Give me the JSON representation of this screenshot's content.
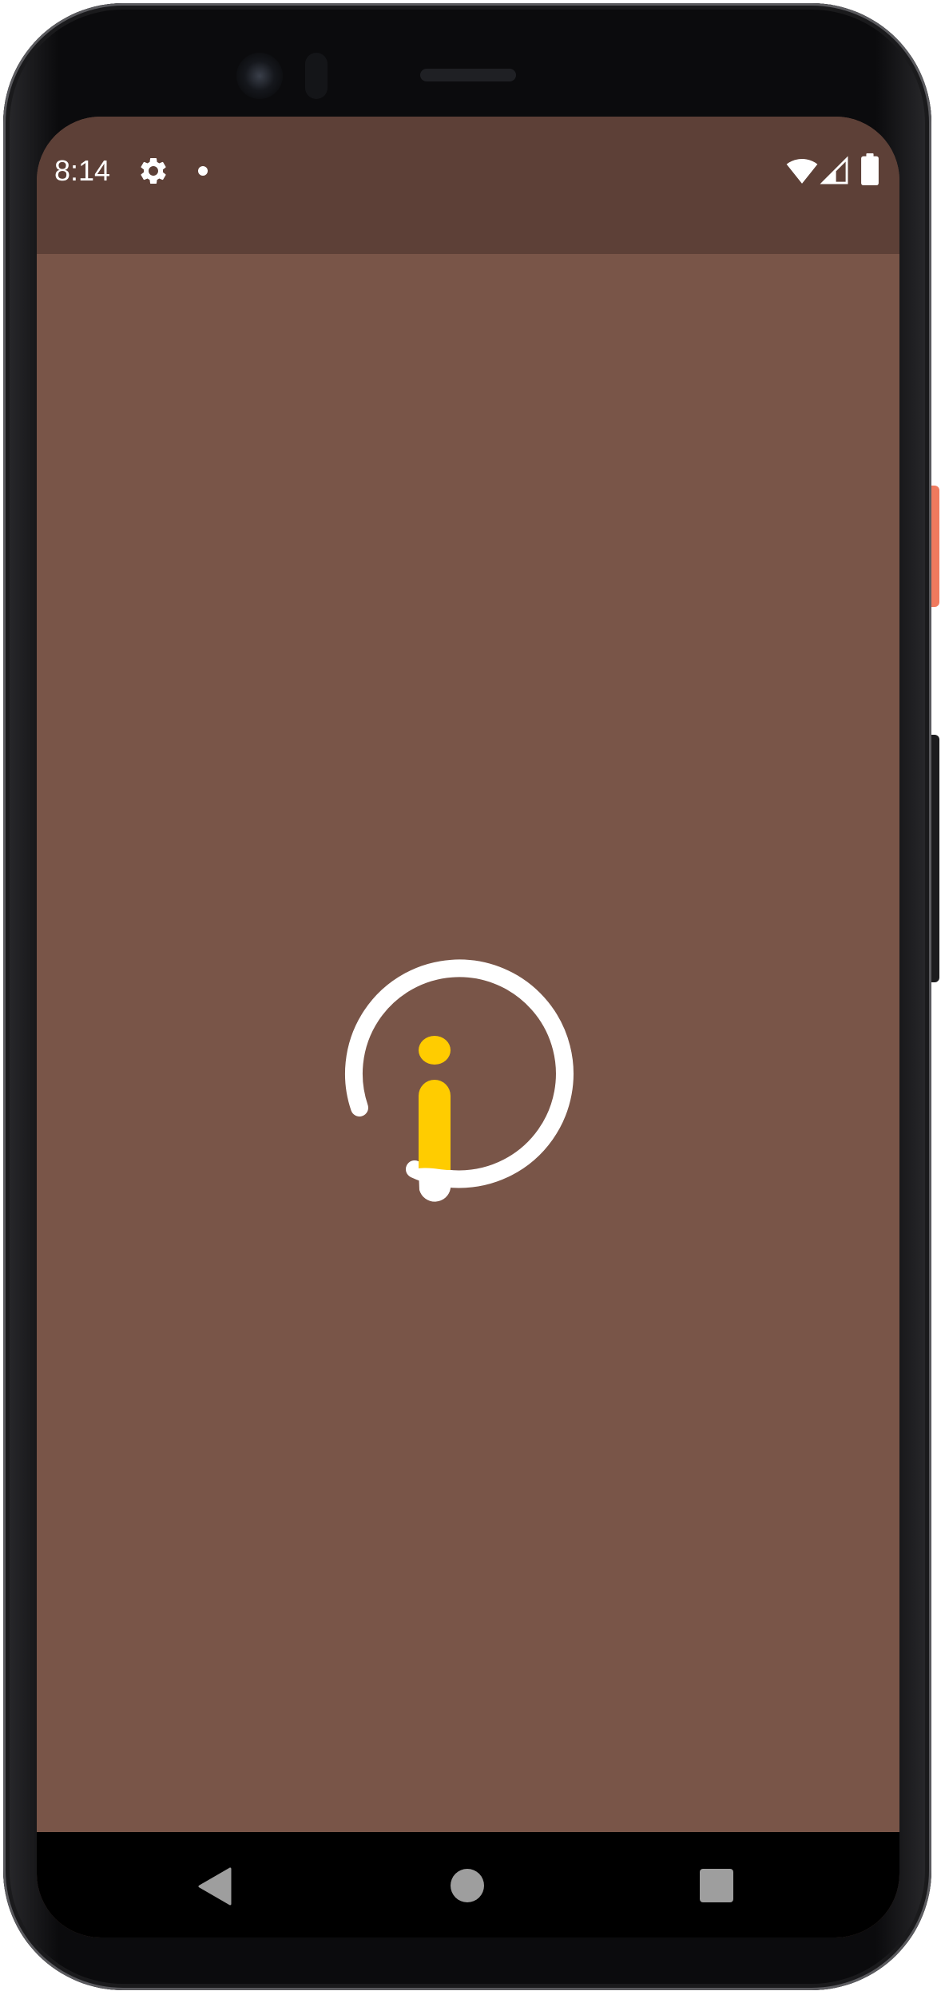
{
  "status_bar": {
    "time": "8:14",
    "icons": [
      "gear-icon",
      "notification-dot-icon",
      "wifi-icon",
      "cell-signal-icon",
      "battery-icon"
    ],
    "background_color": "#5d4037"
  },
  "app": {
    "background_color": "#795548",
    "logo": {
      "icon": "app-logo-i-icon",
      "ring_color": "#ffffff",
      "accent_color": "#ffcc00"
    }
  },
  "nav_bar": {
    "buttons": [
      "back-icon",
      "home-icon",
      "recents-icon"
    ],
    "button_color": "#9e9e9e"
  }
}
